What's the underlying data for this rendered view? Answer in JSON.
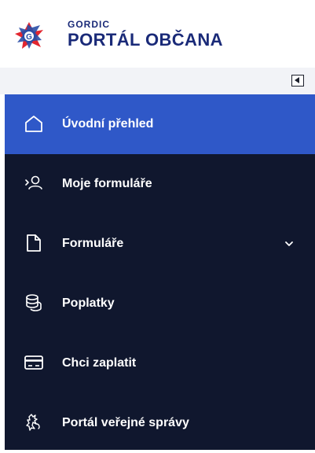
{
  "brand": {
    "small": "GORDIC",
    "big": "PORTÁL OBČANA"
  },
  "nav": {
    "items": [
      {
        "label": "Úvodní přehled",
        "icon": "home-icon",
        "active": true
      },
      {
        "label": "Moje formuláře",
        "icon": "user-forms-icon"
      },
      {
        "label": "Formuláře",
        "icon": "document-icon",
        "has_submenu": true
      },
      {
        "label": "Poplatky",
        "icon": "coins-icon"
      },
      {
        "label": "Chci zaplatit",
        "icon": "credit-card-icon"
      },
      {
        "label": "Portál veřejné správy",
        "icon": "lion-emblem-icon"
      }
    ]
  },
  "colors": {
    "brand": "#1a2a78",
    "active": "#2f58c8",
    "sidebar": "#10172e",
    "logo_red": "#e2262f",
    "logo_blue": "#2a4ea6"
  }
}
